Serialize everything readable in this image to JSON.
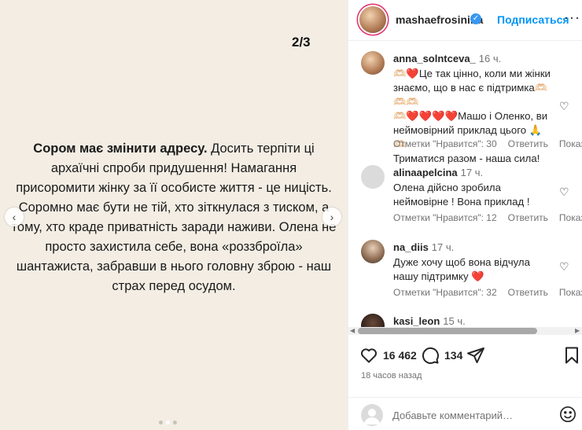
{
  "media": {
    "page_indicator": "2/3",
    "text_bold": "Сором має змінити адресу.",
    "text_rest": " Досить терпіти ці архаїчні спроби придушення! Намагання присоромити жінку за її особисте життя - це ницість. Соромно має бути не тій, хто зіткнулася з тиском, а тому, хто краде приватність заради наживи. Олена не просто захистила себе, вона «роззброїла» шантажиста, забравши в нього головну зброю - наш страх перед осудом.",
    "prev_icon": "chevron-left",
    "next_icon": "chevron-right",
    "carousel_total": 3,
    "carousel_active": 2
  },
  "header": {
    "username": "mashaefrosinina",
    "verified": true,
    "follow_label": "Подписаться",
    "more_icon": "ellipsis"
  },
  "comments": [
    {
      "user": "anna_solntceva_",
      "time": "16 ч.",
      "text_lines": [
        "🫶🏻❤️Це так цінно, коли ми жінки",
        "знаємо, що в нас є підтримка🫶🏻🫶🏻🫶🏻",
        "🫶🏻❤️❤️❤️❤️Машо і Оленко, ви",
        "неймовірний приклад цього 🙏🫶🏻",
        "Триматися разом - наша сила!"
      ],
      "likes": "Отметки \"Нравится\": 30",
      "reply": "Ответить",
      "translate": "Показать перевод"
    },
    {
      "user": "alinaapelcina",
      "time": "17 ч.",
      "text_lines": [
        "Олена дійсно зробила",
        "неймовірне ! Вона приклад !"
      ],
      "likes": "Отметки \"Нравится\": 12",
      "reply": "Ответить",
      "translate": "Показать перевод"
    },
    {
      "user": "na_diis",
      "time": "17 ч.",
      "text_lines": [
        "Дуже хочу щоб вона відчула",
        "нашу підтримку ❤️"
      ],
      "likes": "Отметки \"Нравится\": 32",
      "reply": "Ответить",
      "translate": "Показать перевод"
    },
    {
      "user": "kasi_leon",
      "time": "15 ч."
    }
  ],
  "actions": {
    "likes_count": "16 462",
    "comments_count": "134",
    "like_icon": "heart",
    "comment_icon": "speech-bubble",
    "share_icon": "paper-plane",
    "save_icon": "bookmark"
  },
  "post_time": "18 часов назад",
  "comment_input": {
    "placeholder": "Добавьте комментарий…",
    "emoji_icon": "smiley"
  },
  "colors": {
    "media_bg": "#f3ede4",
    "accent": "#0095f6",
    "heart": "#ed1c3c"
  }
}
